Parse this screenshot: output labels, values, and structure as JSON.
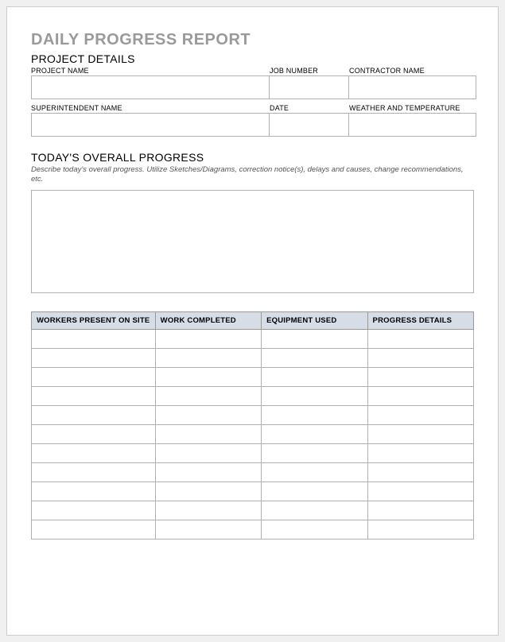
{
  "title": "DAILY PROGRESS REPORT",
  "sections": {
    "details_heading": "PROJECT DETAILS",
    "progress_heading": "TODAY'S OVERALL PROGRESS",
    "progress_helper": "Describe today's overall progress.  Utilize Sketches/Diagrams, correction notice(s), delays and causes, change recommendations, etc."
  },
  "fields": {
    "project_name": {
      "label": "PROJECT NAME",
      "value": ""
    },
    "job_number": {
      "label": "JOB NUMBER",
      "value": ""
    },
    "contractor_name": {
      "label": "CONTRACTOR NAME",
      "value": ""
    },
    "superintendent_name": {
      "label": "SUPERINTENDENT NAME",
      "value": ""
    },
    "date": {
      "label": "DATE",
      "value": ""
    },
    "weather": {
      "label": "WEATHER AND TEMPERATURE",
      "value": ""
    }
  },
  "progress_text": "",
  "table": {
    "headers": [
      "WORKERS PRESENT ON SITE",
      "WORK COMPLETED",
      "EQUIPMENT USED",
      "PROGRESS DETAILS"
    ],
    "rows": [
      [
        "",
        "",
        "",
        ""
      ],
      [
        "",
        "",
        "",
        ""
      ],
      [
        "",
        "",
        "",
        ""
      ],
      [
        "",
        "",
        "",
        ""
      ],
      [
        "",
        "",
        "",
        ""
      ],
      [
        "",
        "",
        "",
        ""
      ],
      [
        "",
        "",
        "",
        ""
      ],
      [
        "",
        "",
        "",
        ""
      ],
      [
        "",
        "",
        "",
        ""
      ],
      [
        "",
        "",
        "",
        ""
      ],
      [
        "",
        "",
        "",
        ""
      ]
    ]
  }
}
